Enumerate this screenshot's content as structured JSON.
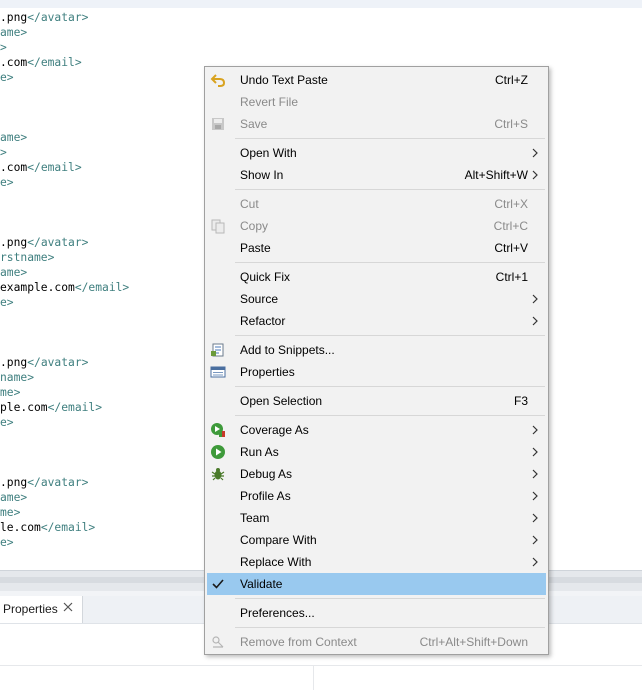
{
  "editor": {
    "lines": [
      {
        "text": ".png",
        "tag": "</avatar>"
      },
      {
        "text": "",
        "tag": "ame>"
      },
      {
        "text": "",
        "tag": ">"
      },
      {
        "text": ".com",
        "tag": "</email>"
      },
      {
        "text": "",
        "tag": "e>"
      },
      {
        "text": "",
        "tag": "ame>"
      },
      {
        "text": "",
        "tag": ">"
      },
      {
        "text": ".com",
        "tag": "</email>"
      },
      {
        "text": "",
        "tag": "e>"
      },
      {
        "text": ".png",
        "tag": "</avatar>"
      },
      {
        "text": "",
        "tag": "rstname>"
      },
      {
        "text": "",
        "tag": "ame>"
      },
      {
        "text": "example.com",
        "tag": "</email>"
      },
      {
        "text": "",
        "tag": "e>"
      },
      {
        "text": ".png",
        "tag": "</avatar>"
      },
      {
        "text": "",
        "tag": "name>"
      },
      {
        "text": "",
        "tag": "me>"
      },
      {
        "text": "ple.com",
        "tag": "</email>"
      },
      {
        "text": "",
        "tag": "e>"
      },
      {
        "text": ".png",
        "tag": "</avatar>"
      },
      {
        "text": "",
        "tag": "ame>"
      },
      {
        "text": "",
        "tag": "me>"
      },
      {
        "text": "le.com",
        "tag": "</email>"
      },
      {
        "text": "",
        "tag": "e>"
      }
    ]
  },
  "panel": {
    "tab_label": "Properties",
    "close_icon": "close-icon"
  },
  "menu": {
    "items": [
      {
        "label": "Undo Text Paste",
        "accelerator": "Ctrl+Z",
        "icon": "undo-icon",
        "enabled": true
      },
      {
        "label": "Revert File",
        "accelerator": "",
        "enabled": false
      },
      {
        "label": "Save",
        "accelerator": "Ctrl+S",
        "icon": "save-icon",
        "enabled": false
      },
      {
        "label": "Open With",
        "submenu": true,
        "enabled": true
      },
      {
        "label": "Show In",
        "accelerator": "Alt+Shift+W",
        "submenu": true,
        "enabled": true
      },
      {
        "label": "Cut",
        "accelerator": "Ctrl+X",
        "enabled": false
      },
      {
        "label": "Copy",
        "accelerator": "Ctrl+C",
        "icon": "copy-icon",
        "enabled": false
      },
      {
        "label": "Paste",
        "accelerator": "Ctrl+V",
        "enabled": true
      },
      {
        "label": "Quick Fix",
        "accelerator": "Ctrl+1",
        "enabled": true
      },
      {
        "label": "Source",
        "submenu": true,
        "enabled": true
      },
      {
        "label": "Refactor",
        "submenu": true,
        "enabled": true
      },
      {
        "label": "Add to Snippets...",
        "icon": "snippets-icon",
        "enabled": true
      },
      {
        "label": "Properties",
        "icon": "properties-icon",
        "enabled": true
      },
      {
        "label": "Open Selection",
        "accelerator": "F3",
        "enabled": true
      },
      {
        "label": "Coverage As",
        "icon": "coverage-icon",
        "submenu": true,
        "enabled": true
      },
      {
        "label": "Run As",
        "icon": "run-icon",
        "submenu": true,
        "enabled": true
      },
      {
        "label": "Debug As",
        "icon": "debug-bug-icon",
        "submenu": true,
        "enabled": true
      },
      {
        "label": "Profile As",
        "submenu": true,
        "enabled": true
      },
      {
        "label": "Team",
        "submenu": true,
        "enabled": true
      },
      {
        "label": "Compare With",
        "submenu": true,
        "enabled": true
      },
      {
        "label": "Replace With",
        "submenu": true,
        "enabled": true
      },
      {
        "label": "Validate",
        "icon": "checkbox-checked-icon",
        "checked": true,
        "selected": true,
        "enabled": true
      },
      {
        "label": "Preferences...",
        "enabled": true
      },
      {
        "label": "Remove from Context",
        "accelerator": "Ctrl+Alt+Shift+Down",
        "icon": "remove-context-icon",
        "enabled": false
      }
    ]
  },
  "colors": {
    "selection": "#99c9ef",
    "menu_background": "#f2f2f2",
    "xml_tag": "#3f7f7f"
  }
}
